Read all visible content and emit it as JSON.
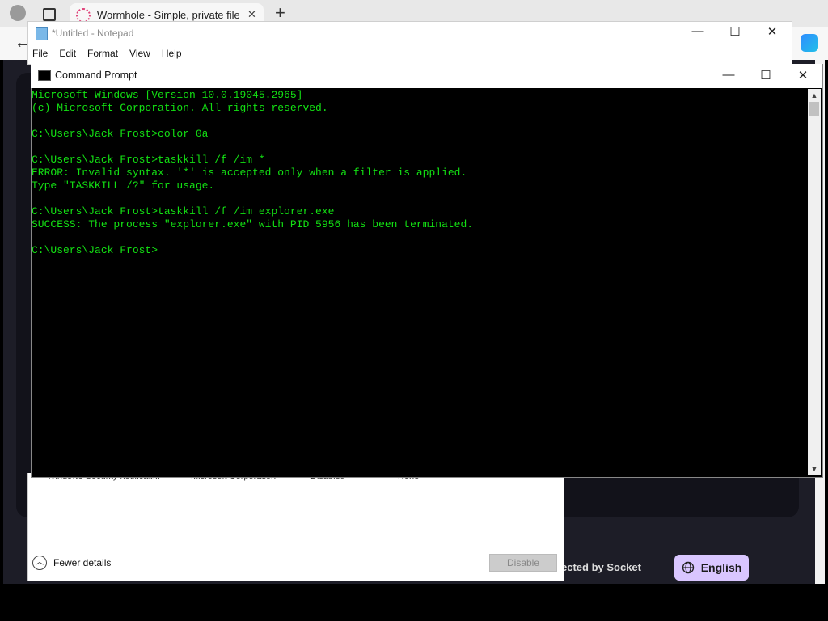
{
  "browser": {
    "tab_title": "Wormhole - Simple, private file sh",
    "new_tab_symbol": "+",
    "close_tab_symbol": "✕",
    "back_symbol": "←",
    "footer_text": "ected by Socket",
    "language_button": "English"
  },
  "notepad": {
    "title": "*Untitled - Notepad",
    "menu": [
      "File",
      "Edit",
      "Format",
      "View",
      "Help"
    ]
  },
  "taskmgr": {
    "behind_row": [
      "Windows Security notificati...",
      "Microsoft Corporation",
      "Disabled",
      "None"
    ],
    "fewer_details": "Fewer details",
    "disable_button": "Disable"
  },
  "cmd": {
    "title": "Command Prompt",
    "lines": [
      "Microsoft Windows [Version 10.0.19045.2965]",
      "(c) Microsoft Corporation. All rights reserved.",
      "",
      "C:\\Users\\Jack Frost>color 0a",
      "",
      "C:\\Users\\Jack Frost>taskkill /f /im *",
      "ERROR: Invalid syntax. '*' is accepted only when a filter is applied.",
      "Type \"TASKKILL /?\" for usage.",
      "",
      "C:\\Users\\Jack Frost>taskkill /f /im explorer.exe",
      "SUCCESS: The process \"explorer.exe\" with PID 5956 has been terminated.",
      "",
      "C:\\Users\\Jack Frost>"
    ],
    "text_color": "#13e013"
  }
}
